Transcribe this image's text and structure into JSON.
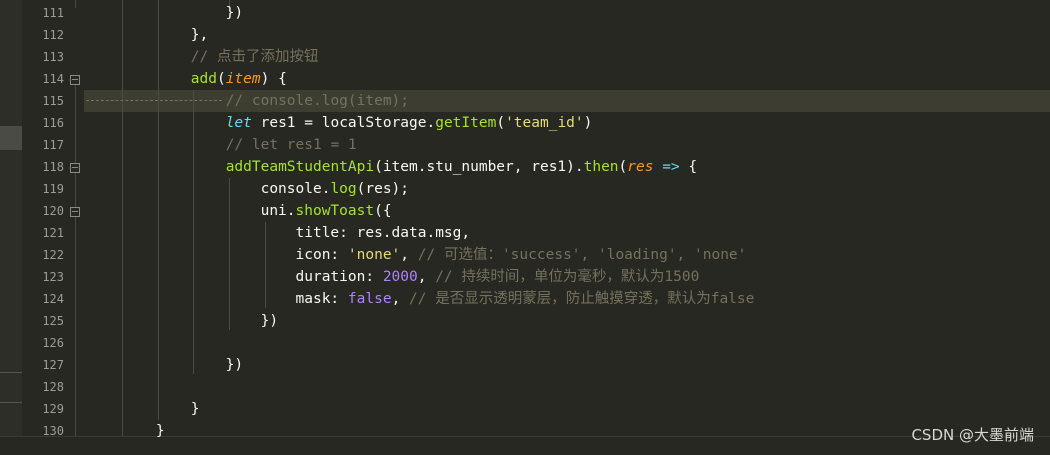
{
  "editor": {
    "lines": [
      {
        "n": "111",
        "code": "                })"
      },
      {
        "n": "112",
        "code": "            },"
      },
      {
        "n": "113",
        "code": "            // 点击了添加按钮"
      },
      {
        "n": "114",
        "code": "            add(item) {"
      },
      {
        "n": "115",
        "code": "                // console.log(item);"
      },
      {
        "n": "116",
        "code": "                let res1 = localStorage.getItem('team_id')"
      },
      {
        "n": "117",
        "code": "                // let res1 = 1"
      },
      {
        "n": "118",
        "code": "                addTeamStudentApi(item.stu_number, res1).then(res => {"
      },
      {
        "n": "119",
        "code": "                    console.log(res);"
      },
      {
        "n": "120",
        "code": "                    uni.showToast({"
      },
      {
        "n": "121",
        "code": "                        title: res.data.msg,"
      },
      {
        "n": "122",
        "code": "                        icon: 'none', // 可选值：'success', 'loading', 'none'"
      },
      {
        "n": "123",
        "code": "                        duration: 2000, // 持续时间，单位为毫秒，默认为1500"
      },
      {
        "n": "124",
        "code": "                        mask: false, // 是否显示透明蒙层，防止触摸穿透，默认为false"
      },
      {
        "n": "125",
        "code": "                    })"
      },
      {
        "n": "126",
        "code": ""
      },
      {
        "n": "127",
        "code": "                })"
      },
      {
        "n": "128",
        "code": ""
      },
      {
        "n": "129",
        "code": "            }"
      },
      {
        "n": "130",
        "code": "        }"
      }
    ],
    "highlighted_line": "115",
    "fold_markers": [
      "114",
      "118",
      "120"
    ]
  },
  "watermark": "CSDN @大墨前端",
  "colors": {
    "background": "#272822",
    "function": "#a6e22e",
    "param": "#fd971f",
    "keyword": "#66d9ef",
    "string": "#e6db74",
    "number": "#ae81ff",
    "comment": "#75715e"
  }
}
